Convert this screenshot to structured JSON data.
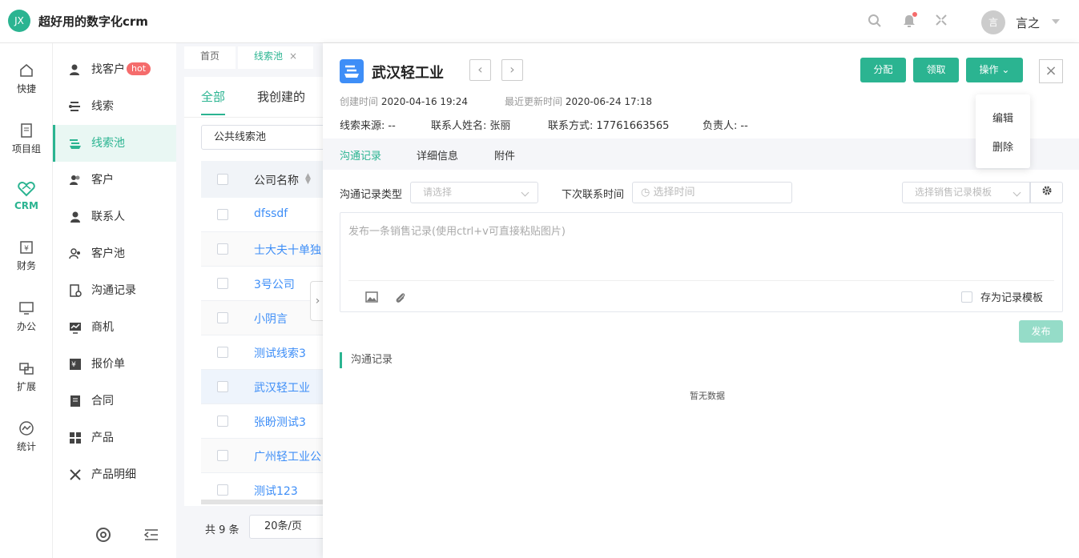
{
  "header": {
    "logo_text": "JX",
    "app_title": "超好用的数字化crm",
    "user_avatar_text": "言",
    "user_name": "言之"
  },
  "rail": {
    "items": [
      {
        "label": "快捷",
        "icon": "home-icon"
      },
      {
        "label": "项目组",
        "icon": "document-icon"
      },
      {
        "label": "CRM",
        "icon": "crm-heart-icon"
      },
      {
        "label": "财务",
        "icon": "finance-icon"
      },
      {
        "label": "办公",
        "icon": "monitor-icon"
      },
      {
        "label": "扩展",
        "icon": "extend-icon"
      },
      {
        "label": "统计",
        "icon": "stats-icon"
      }
    ]
  },
  "sidebar": {
    "items": [
      {
        "label": "找客户",
        "badge": "hot"
      },
      {
        "label": "线索"
      },
      {
        "label": "线索池"
      },
      {
        "label": "客户"
      },
      {
        "label": "联系人"
      },
      {
        "label": "客户池"
      },
      {
        "label": "沟通记录"
      },
      {
        "label": "商机"
      },
      {
        "label": "报价单"
      },
      {
        "label": "合同"
      },
      {
        "label": "产品"
      },
      {
        "label": "产品明细"
      }
    ]
  },
  "page_tabs": [
    {
      "label": "首页"
    },
    {
      "label": "线索池",
      "close": "×"
    }
  ],
  "list": {
    "tabs": [
      "全部",
      "我创建的"
    ],
    "pool_select": "公共线索池",
    "column_header": "公司名称",
    "rows": [
      "dfssdf",
      "士大夫十单独",
      "3号公司",
      "小阴言",
      "测试线索3",
      "武汉轻工业",
      "张盼测试3",
      "广州轻工业公",
      "测试123"
    ],
    "total": "共 9 条",
    "page_size": "20条/页"
  },
  "detail": {
    "title": "武汉轻工业",
    "buttons": {
      "assign": "分配",
      "claim": "领取",
      "actions": "操作"
    },
    "created_label": "创建时间",
    "created_value": "2020-04-16 19:24",
    "updated_label": "最近更新时间",
    "updated_value": "2020-06-24 17:18",
    "source_label": "线索来源:",
    "source_value": "--",
    "contact_label": "联系人姓名:",
    "contact_value": "张丽",
    "phone_label": "联系方式:",
    "phone_value": "17761663565",
    "owner_label": "负责人:",
    "owner_value": "--",
    "tabs": [
      "沟通记录",
      "详细信息",
      "附件"
    ],
    "record_type_label": "沟通记录类型",
    "record_type_placeholder": "请选择",
    "next_contact_label": "下次联系时间",
    "next_contact_placeholder": "选择时间",
    "template_placeholder": "选择销售记录模板",
    "editor_placeholder": "发布一条销售记录(使用ctrl+v可直接粘贴图片)",
    "save_template": "存为记录模板",
    "publish": "发布",
    "records_title": "沟通记录",
    "empty_text": "暂无数据"
  },
  "dropdown": {
    "items": [
      "编辑",
      "删除"
    ]
  },
  "colors": {
    "accent": "#2bb491",
    "link": "#3e8ef7",
    "badge": "#f56c6c"
  }
}
